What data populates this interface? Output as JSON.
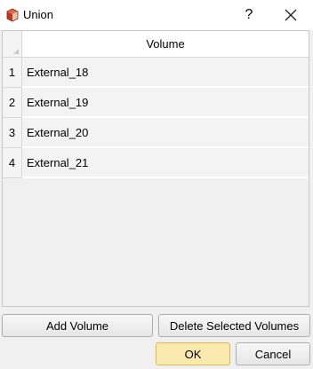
{
  "window": {
    "title": "Union",
    "help_label": "?"
  },
  "grid": {
    "column_header": "Volume",
    "rows": [
      {
        "index": "1",
        "volume": "External_18"
      },
      {
        "index": "2",
        "volume": "External_19"
      },
      {
        "index": "3",
        "volume": "External_20"
      },
      {
        "index": "4",
        "volume": "External_21"
      }
    ]
  },
  "actions": {
    "add_volume_label": "Add Volume",
    "delete_selected_label": "Delete Selected Volumes",
    "ok_label": "OK",
    "cancel_label": "Cancel"
  },
  "colors": {
    "ok_button": "#fbeab0",
    "ok_border": "#e0b84a"
  }
}
